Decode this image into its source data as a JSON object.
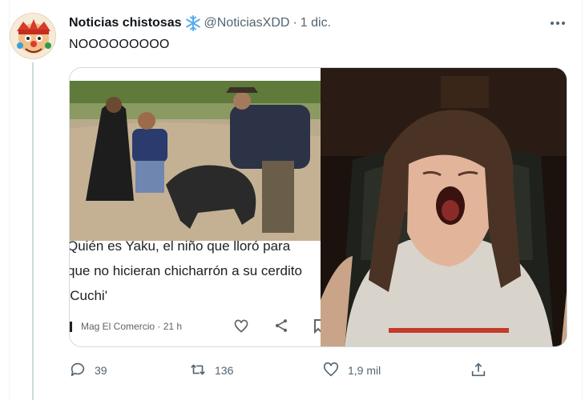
{
  "tweet": {
    "display_name": "Noticias chistosas",
    "name_emoji": "snowflake-icon",
    "handle": "@NoticiasXDD",
    "separator": "·",
    "date": "1 dic.",
    "text": "NOOOOOOOOO",
    "more_icon": "more-icon"
  },
  "media": {
    "left": {
      "headline_lines": [
        "Quién es Yaku, el niño que lloró para",
        "que no hicieran chicharrón a su cerdito",
        "'Cuchi'"
      ],
      "source": "Mag El Comercio · 21 h"
    }
  },
  "actions": {
    "reply_count": "39",
    "retweet_count": "136",
    "like_count": "1,9 mil"
  },
  "colors": {
    "text_primary": "#0f1419",
    "text_secondary": "#536471",
    "snowflake": "#55acee",
    "border": "#cfd9de"
  }
}
